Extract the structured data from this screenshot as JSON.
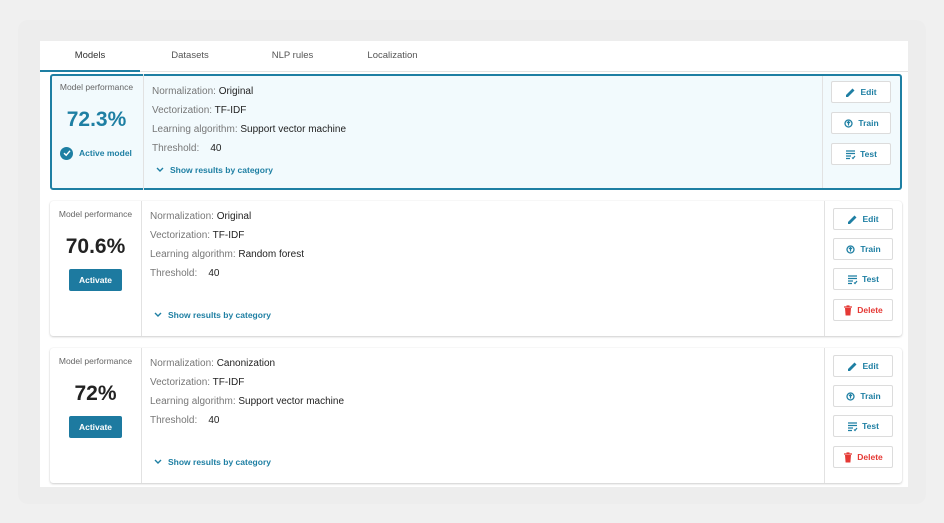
{
  "tabs": [
    {
      "label": "Models",
      "active": true
    },
    {
      "label": "Datasets",
      "active": false
    },
    {
      "label": "NLP rules",
      "active": false
    },
    {
      "label": "Localization",
      "active": false
    }
  ],
  "labels": {
    "model_performance": "Model performance",
    "normalization": "Normalization:",
    "vectorization": "Vectorization:",
    "learning_algorithm": "Learning algorithm:",
    "threshold": "Threshold:",
    "show_results": "Show results by category",
    "active_model": "Active model",
    "activate": "Activate",
    "edit": "Edit",
    "train": "Train",
    "test": "Test",
    "delete": "Delete"
  },
  "models": [
    {
      "performance": "72.3%",
      "normalization": "Original",
      "vectorization": "TF-IDF",
      "learning_algorithm": "Support vector machine",
      "threshold": "40",
      "active": true
    },
    {
      "performance": "70.6%",
      "normalization": "Original",
      "vectorization": "TF-IDF",
      "learning_algorithm": "Random forest",
      "threshold": "40",
      "active": false
    },
    {
      "performance": "72%",
      "normalization": "Canonization",
      "vectorization": "TF-IDF",
      "learning_algorithm": "Support vector machine",
      "threshold": "40",
      "active": false
    }
  ],
  "colors": {
    "accent": "#1e7fa3",
    "delete": "#e53935",
    "selected_bg": "#f2fafd"
  }
}
